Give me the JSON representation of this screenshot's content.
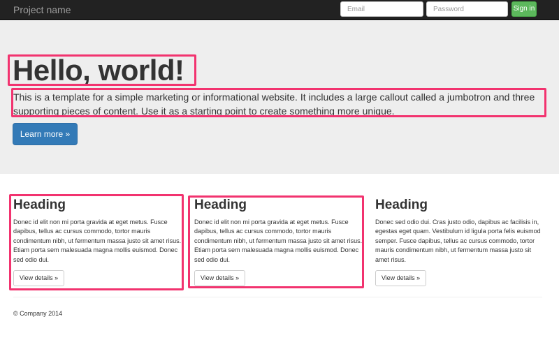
{
  "navbar": {
    "brand": "Project name",
    "email_placeholder": "Email",
    "password_placeholder": "Password",
    "signin_label": "Sign in"
  },
  "jumbotron": {
    "title": "Hello, world!",
    "text": "This is a template for a simple marketing or informational website. It includes a large callout called a jumbotron and three supporting pieces of content. Use it as a starting point to create something more unique.",
    "button_label": "Learn more »"
  },
  "columns": [
    {
      "heading": "Heading",
      "text": "Donec id elit non mi porta gravida at eget metus. Fusce dapibus, tellus ac cursus commodo, tortor mauris condimentum nibh, ut fermentum massa justo sit amet risus. Etiam porta sem malesuada magna mollis euismod. Donec sed odio dui.",
      "button_label": "View details »"
    },
    {
      "heading": "Heading",
      "text": "Donec id elit non mi porta gravida at eget metus. Fusce dapibus, tellus ac cursus commodo, tortor mauris condimentum nibh, ut fermentum massa justo sit amet risus. Etiam porta sem malesuada magna mollis euismod. Donec sed odio dui.",
      "button_label": "View details »"
    },
    {
      "heading": "Heading",
      "text": "Donec sed odio dui. Cras justo odio, dapibus ac facilisis in, egestas eget quam. Vestibulum id ligula porta felis euismod semper. Fusce dapibus, tellus ac cursus commodo, tortor mauris condimentum nibh, ut fermentum massa justo sit amet risus.",
      "button_label": "View details »"
    }
  ],
  "footer": {
    "text": "© Company 2014"
  },
  "colors": {
    "navbar_bg": "#222222",
    "jumbotron_bg": "#eeeeee",
    "primary": "#337ab7",
    "success": "#5cb85c",
    "highlight": "#f2336f"
  }
}
